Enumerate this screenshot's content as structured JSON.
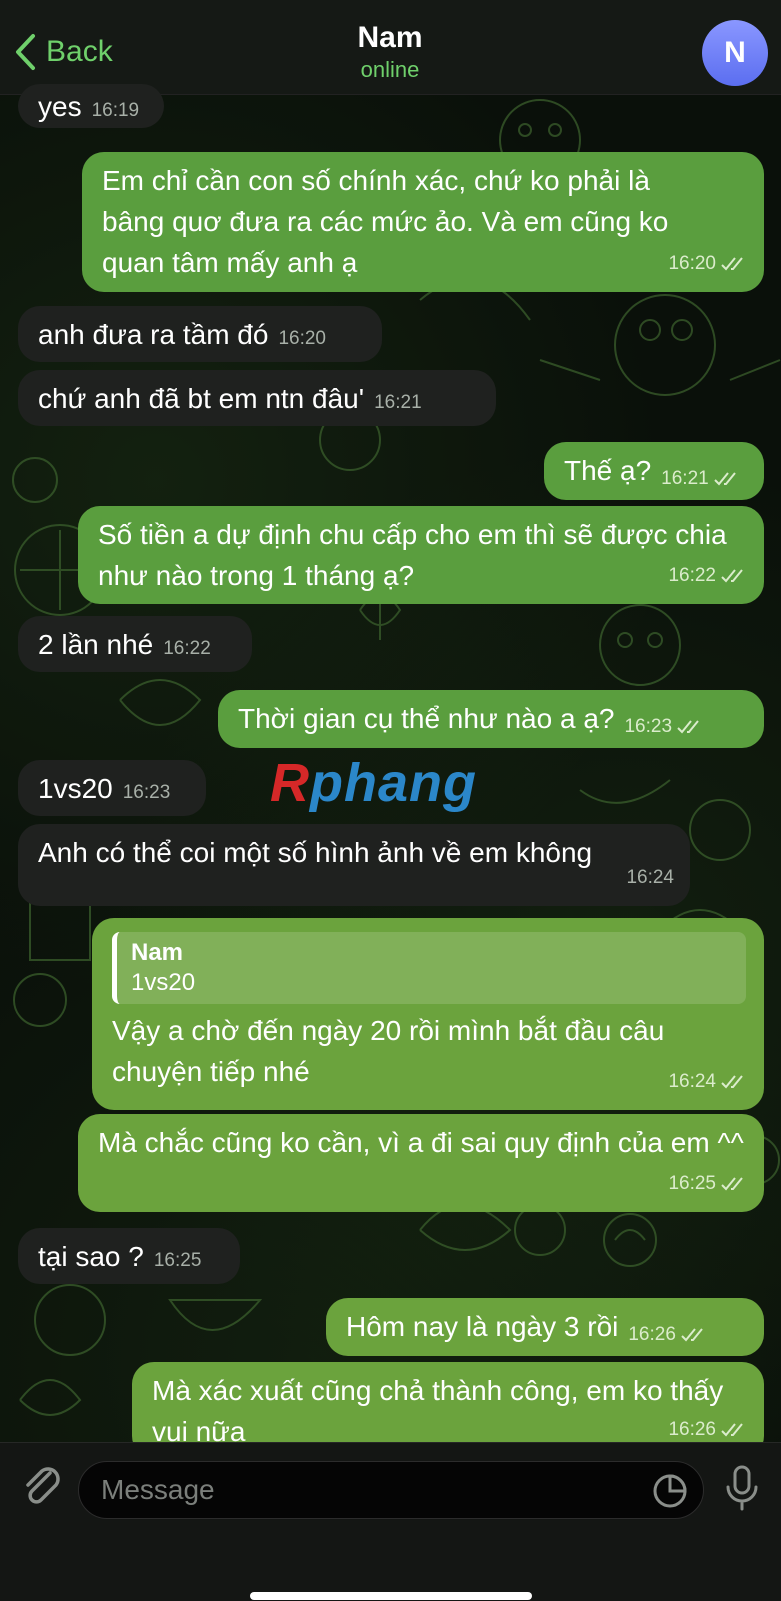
{
  "header": {
    "back_label": "Back",
    "title": "Nam",
    "status": "online",
    "avatar_letter": "N"
  },
  "messages": [
    {
      "dir": "in",
      "text": "yes",
      "time": "16:19"
    },
    {
      "dir": "out",
      "text": "Em chỉ cần con số chính xác, chứ ko phải là bâng quơ đưa ra các mức ảo. Và em cũng ko quan tâm mấy anh ạ",
      "time": "16:20"
    },
    {
      "dir": "in",
      "text": "anh đưa ra tầm đó",
      "time": "16:20"
    },
    {
      "dir": "in",
      "text": "chứ anh đã bt em ntn đâu'",
      "time": "16:21"
    },
    {
      "dir": "out",
      "text": "Thế ạ?",
      "time": "16:21"
    },
    {
      "dir": "out",
      "text": "Số tiền a dự định chu cấp cho em thì sẽ được chia như nào trong 1 tháng ạ?",
      "time": "16:22"
    },
    {
      "dir": "in",
      "text": "2 lần nhé",
      "time": "16:22"
    },
    {
      "dir": "out",
      "text": "Thời gian cụ thể như nào a ạ?",
      "time": "16:23"
    },
    {
      "dir": "in",
      "text": "1vs20",
      "time": "16:23"
    },
    {
      "dir": "in",
      "text": "Anh có thể coi một số hình ảnh về em không",
      "time": "16:24"
    },
    {
      "dir": "out",
      "reply_name": "Nam",
      "reply_text": "1vs20",
      "text": "Vậy a chờ đến ngày 20 rồi mình bắt đầu câu chuyện tiếp nhé",
      "time": "16:24"
    },
    {
      "dir": "out",
      "text": "Mà chắc cũng ko cần, vì a đi sai quy định của em ^^",
      "time": "16:25"
    },
    {
      "dir": "in",
      "text": "tại sao ?",
      "time": "16:25"
    },
    {
      "dir": "out",
      "text": "Hôm nay là ngày 3 rồi",
      "time": "16:26"
    },
    {
      "dir": "out",
      "text": "Mà xác xuất cũng chả thành công, em ko thấy vui nữa",
      "time": "16:26"
    }
  ],
  "watermark": {
    "r": "R",
    "rest": "phang"
  },
  "composer": {
    "placeholder": "Message"
  },
  "colors": {
    "accent": "#6fd06b",
    "bubble_out": "#5a9e3e",
    "bubble_in": "#1f211f"
  },
  "icons": [
    "back-chevron-icon",
    "attach-icon",
    "sticker-icon",
    "mic-icon",
    "double-check-icon"
  ]
}
